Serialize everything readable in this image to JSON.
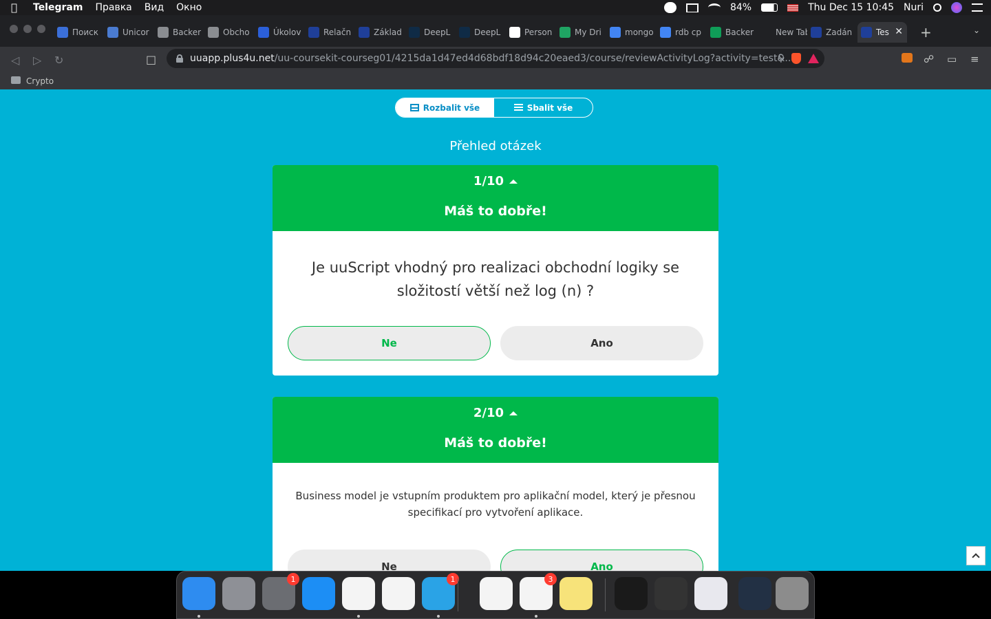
{
  "menubar": {
    "app": "Telegram",
    "items": [
      "Правка",
      "Вид",
      "Окно"
    ],
    "battery": "84%",
    "datetime": "Thu Dec 15  10:45",
    "user": "Nuri"
  },
  "browser": {
    "tabs": [
      {
        "label": "Поиск",
        "color": "#3b6fd8"
      },
      {
        "label": "Unicor",
        "color": "#4a7bd0"
      },
      {
        "label": "Backer",
        "color": "#8a8d91"
      },
      {
        "label": "Obcho",
        "color": "#8a8d91"
      },
      {
        "label": "Úkolov",
        "color": "#2b5fd9"
      },
      {
        "label": "Relačn",
        "color": "#1f3f99"
      },
      {
        "label": "Základ",
        "color": "#1f3f99"
      },
      {
        "label": "DeepL",
        "color": "#0f2b46"
      },
      {
        "label": "DeepL",
        "color": "#0f2b46"
      },
      {
        "label": "Person",
        "color": "#ffffff"
      },
      {
        "label": "My Dri",
        "color": "#1fa463"
      },
      {
        "label": "mongo",
        "color": "#4285f4"
      },
      {
        "label": "rdb cp",
        "color": "#4285f4"
      },
      {
        "label": "Backer",
        "color": "#0f9d58"
      },
      {
        "label": "New Tab",
        "color": "#202124"
      },
      {
        "label": "Zadán",
        "color": "#1f3f99"
      },
      {
        "label": "Tes",
        "color": "#1f3f99"
      }
    ],
    "url_host": "uuapp.plus4u.net",
    "url_path": "/uu-coursekit-courseg01/4215da1d47ed4d68bdf18d94c20eaed3/course/reviewActivityLog?activity=test&...",
    "bookmark_folder": "Crypto"
  },
  "page": {
    "expand_all": "Rozbalit vše",
    "collapse_all": "Sbalit vše",
    "section_title": "Přehled otázek",
    "questions": [
      {
        "counter": "1/10",
        "verdict": "Máš to dobře!",
        "text": "Je uuScript vhodný pro realizaci obchodní logiky se složitostí větší než log (n) ?",
        "answer_no": "Ne",
        "answer_yes": "Ano"
      },
      {
        "counter": "2/10",
        "verdict": "Máš to dobře!",
        "text": "Business model je vstupním produktem pro aplikační model, který je přesnou specifikací pro vytvoření aplikace.",
        "answer_no": "Ne",
        "answer_yes": "Ano"
      }
    ]
  },
  "dock": {
    "apps": [
      {
        "name": "Finder",
        "color": "#2e8cf0"
      },
      {
        "name": "Launchpad",
        "color": "#8e9096"
      },
      {
        "name": "System Preferences",
        "color": "#6b6d72",
        "badge": "1"
      },
      {
        "name": "App Store",
        "color": "#1c8ef5"
      },
      {
        "name": "Brave",
        "color": "#f4f4f4"
      },
      {
        "name": "Visual Studio Code",
        "color": "#f4f4f4"
      },
      {
        "name": "Telegram",
        "color": "#2aa3e6",
        "badge": "1"
      },
      {
        "name": "Microsoft Teams",
        "color": "#f4f4f4"
      },
      {
        "name": "Microsoft Store",
        "color": "#f4f4f4",
        "badge": "3"
      },
      {
        "name": "Notes",
        "color": "#f7e37a"
      },
      {
        "name": "Window 1",
        "color": "#1a1a1a"
      },
      {
        "name": "Window 2",
        "color": "#333333"
      },
      {
        "name": "Window 3",
        "color": "#e8e8ee"
      },
      {
        "name": "Window 4",
        "color": "#223044"
      },
      {
        "name": "Trash",
        "color": "#8c8c8c"
      }
    ]
  }
}
